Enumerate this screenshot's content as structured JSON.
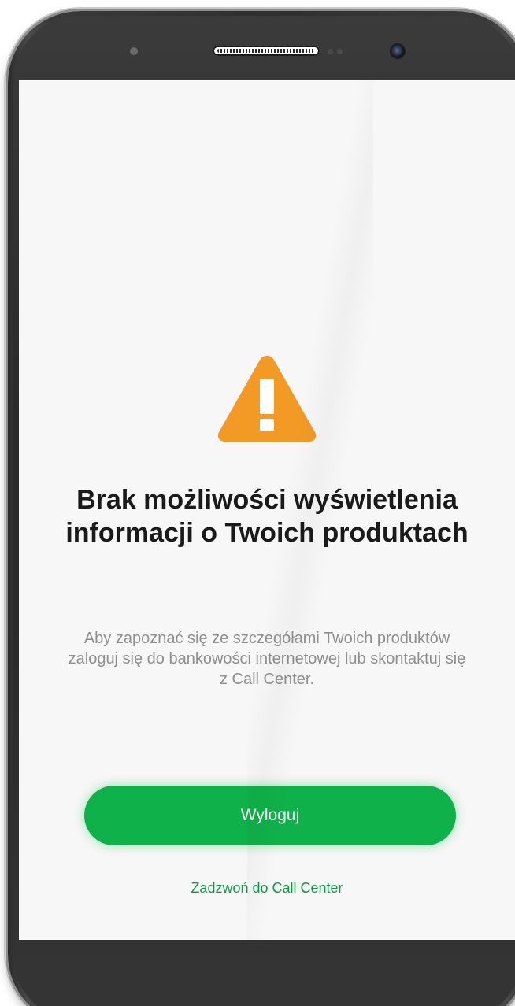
{
  "device": {
    "frame_color": "#2f2f2f",
    "screen_background": "#f7f7f7"
  },
  "alert": {
    "icon": "warning-triangle-icon",
    "icon_color": "#f39a25",
    "title": "Brak możliwości wyświetlenia\ninformacji o Twoich produktach",
    "message": "Aby zapoznać się ze szczegółami Twoich produktów zaloguj się do bankowości internetowej lub skontaktuj się z Call Center."
  },
  "actions": {
    "logout_label": "Wyloguj",
    "logout_color": "#0fb14a",
    "call_center_label": "Zadzwoń do Call Center",
    "call_center_color": "#119a45"
  }
}
